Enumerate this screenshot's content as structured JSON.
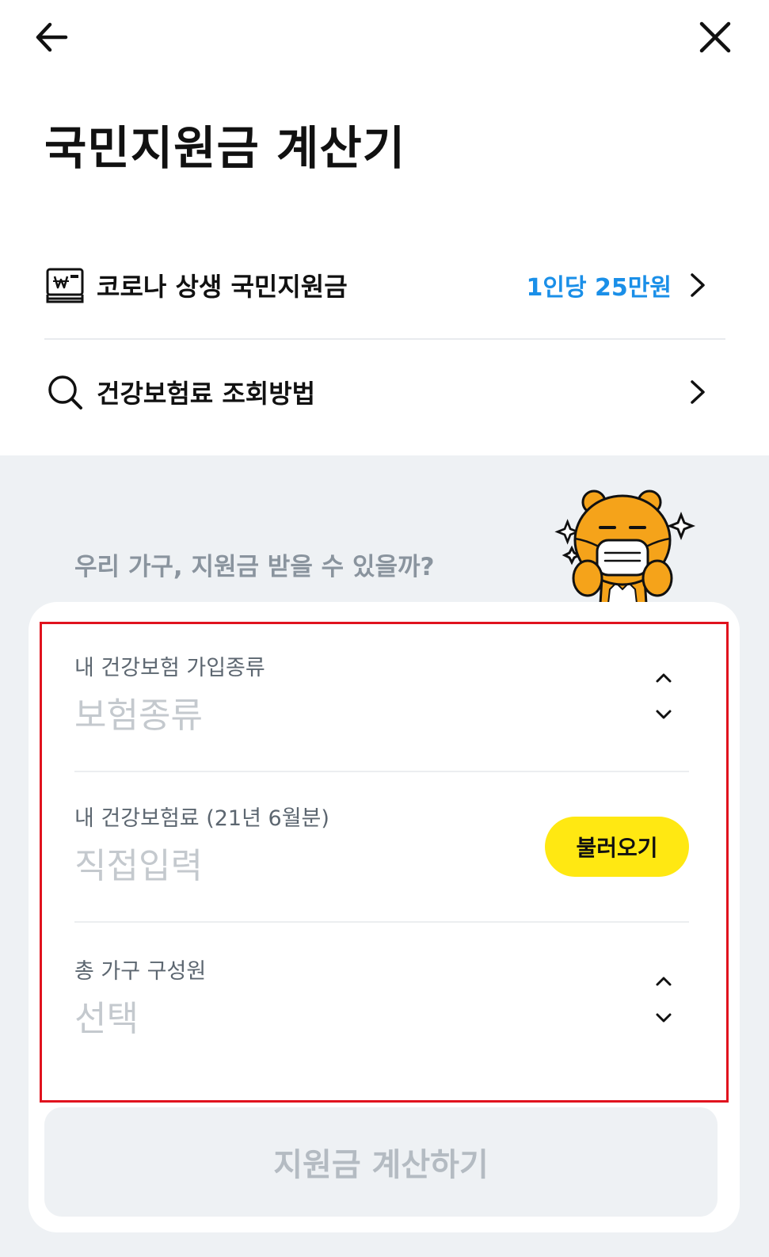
{
  "header": {
    "back_icon": "arrow-left-icon",
    "close_icon": "close-icon",
    "title": "국민지원금 계산기"
  },
  "menu": [
    {
      "icon": "won-card-icon",
      "label": "코로나 상생 국민지원금",
      "value": "1인당 25만원",
      "chevron": "chevron-right-icon"
    },
    {
      "icon": "search-icon",
      "label": "건강보험료 조회방법",
      "chevron": "chevron-right-icon"
    }
  ],
  "section": {
    "question": "우리 가구, 지원금 받을 수 있을까?",
    "mascot": "masked-bear-mascot"
  },
  "form": {
    "insurance_type": {
      "label": "내 건강보험 가입종류",
      "placeholder": "보험종류",
      "icon": "updown-chevron-icon"
    },
    "insurance_fee": {
      "label": "내 건강보험료 (21년 6월분)",
      "placeholder": "직접입력",
      "button": "불러오기"
    },
    "household": {
      "label": "총 가구 구성원",
      "placeholder": "선택",
      "icon": "updown-chevron-icon"
    }
  },
  "submit": {
    "label": "지원금 계산하기"
  },
  "colors": {
    "accent_blue": "#1a8fe8",
    "fetch_yellow": "#ffe812",
    "highlight_red": "#e0131e",
    "section_gray": "#eef1f4"
  }
}
